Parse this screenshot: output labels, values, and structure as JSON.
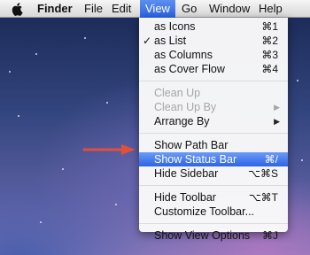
{
  "menubar": {
    "app_name": "Finder",
    "items": [
      {
        "label": "File"
      },
      {
        "label": "Edit"
      },
      {
        "label": "View"
      },
      {
        "label": "Go"
      },
      {
        "label": "Window"
      },
      {
        "label": "Help"
      }
    ],
    "active_item": "View"
  },
  "view_menu": {
    "items": [
      {
        "label": "as Icons",
        "shortcut": "⌘1"
      },
      {
        "label": "as List",
        "shortcut": "⌘2",
        "checked": true
      },
      {
        "label": "as Columns",
        "shortcut": "⌘3"
      },
      {
        "label": "as Cover Flow",
        "shortcut": "⌘4"
      },
      {
        "label": "Clean Up",
        "disabled": true
      },
      {
        "label": "Clean Up By",
        "disabled": true,
        "submenu": true
      },
      {
        "label": "Arrange By",
        "submenu": true
      },
      {
        "label": "Show Path Bar"
      },
      {
        "label": "Show Status Bar",
        "shortcut": "⌘/",
        "highlighted": true
      },
      {
        "label": "Hide Sidebar",
        "shortcut": "⌥⌘S"
      },
      {
        "label": "Hide Toolbar",
        "shortcut": "⌥⌘T"
      },
      {
        "label": "Customize Toolbar..."
      },
      {
        "label": "Show View Options",
        "shortcut": "⌘J"
      }
    ],
    "check_glyph": "✓",
    "submenu_glyph": "▶"
  },
  "colors": {
    "highlight": "#2e64e3",
    "annotation_arrow": "#e0503a"
  },
  "icons": {
    "apple": "apple-icon",
    "annotation": "red-arrow-icon"
  }
}
